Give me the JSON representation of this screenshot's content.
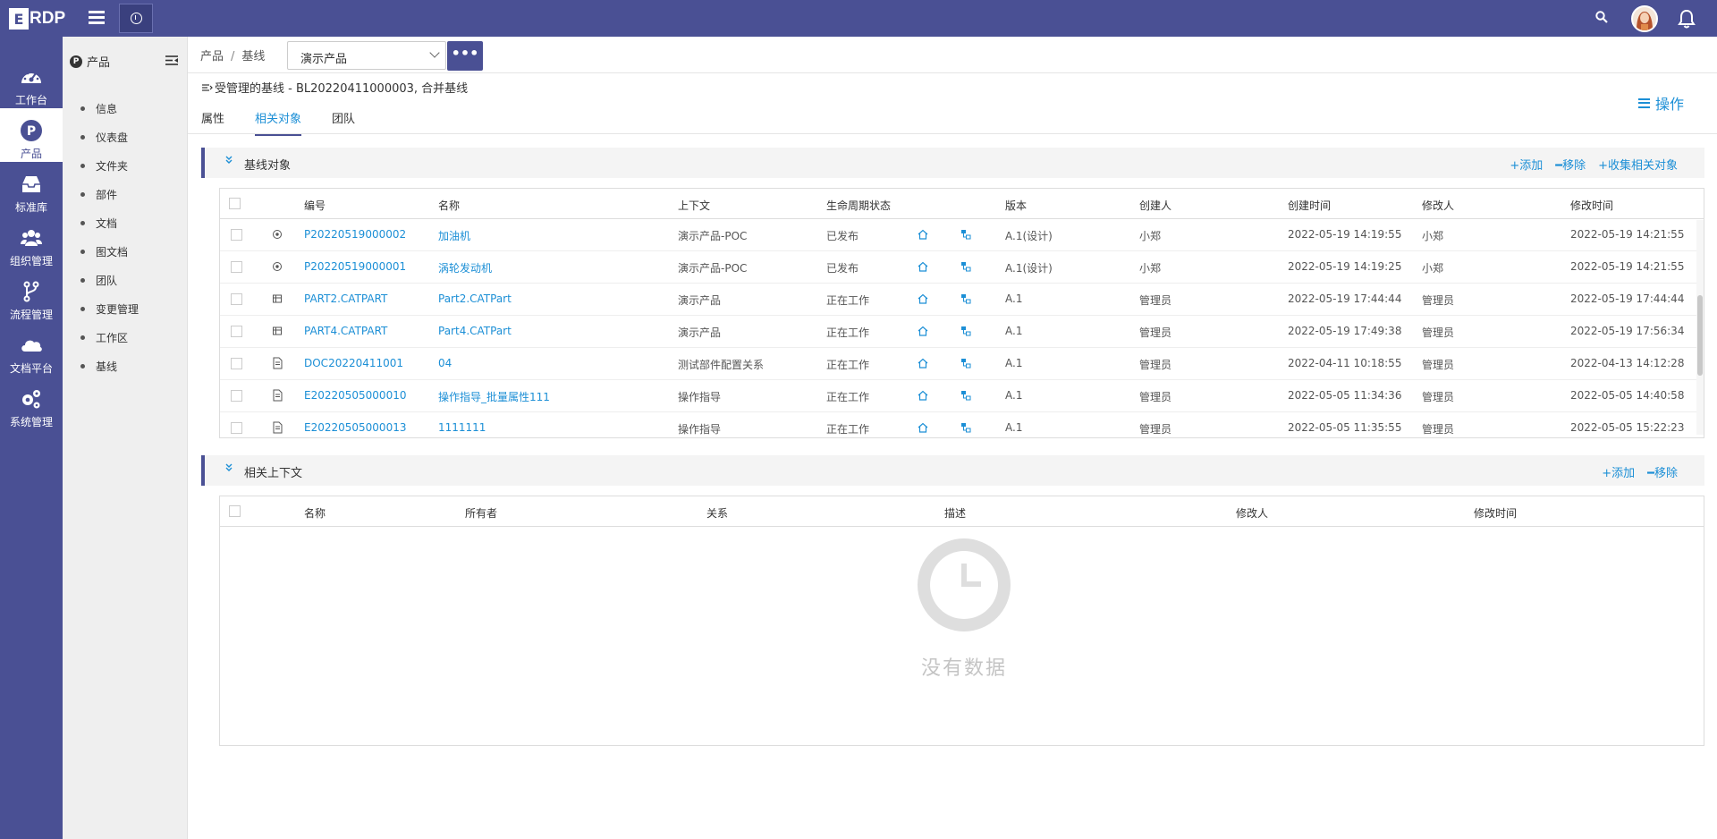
{
  "app": {
    "logo_box": "E",
    "logo_text": "RDP"
  },
  "rail": [
    {
      "label": "工作台",
      "icon": "dashboard-icon"
    },
    {
      "label": "产品",
      "icon": "product-icon",
      "active": true
    },
    {
      "label": "标准库",
      "icon": "inbox-icon"
    },
    {
      "label": "组织管理",
      "icon": "users-icon"
    },
    {
      "label": "流程管理",
      "icon": "flow-icon"
    },
    {
      "label": "文档平台",
      "icon": "cloud-icon"
    },
    {
      "label": "系统管理",
      "icon": "gears-icon"
    }
  ],
  "subnav": {
    "badge": "P",
    "title": "产品",
    "items": [
      "信息",
      "仪表盘",
      "文件夹",
      "部件",
      "文档",
      "图文档",
      "团队",
      "变更管理",
      "工作区",
      "基线"
    ]
  },
  "breadcrumb": {
    "items": [
      "产品",
      "基线"
    ],
    "sep": "/"
  },
  "context": {
    "selected": "演示产品",
    "more": "•••"
  },
  "doc_title": "受管理的基线 - BL20220411000003, 合并基线",
  "tabs": [
    "属性",
    "相关对象",
    "团队"
  ],
  "operate_label": "操作",
  "baseline_section": {
    "title": "基线对象",
    "actions": [
      "+添加",
      "━移除",
      "+收集相关对象"
    ],
    "columns": [
      "编号",
      "名称",
      "上下文",
      "生命周期状态",
      "版本",
      "创建人",
      "创建时间",
      "修改人",
      "修改时间"
    ],
    "rows": [
      {
        "type": "part",
        "number": "P20220519000002",
        "name": "加油机",
        "context": "演示产品-POC",
        "state": "已发布",
        "version": "A.1(设计)",
        "creator": "小郑",
        "created": "2022-05-19 14:19:55",
        "modifier": "小郑",
        "modified": "2022-05-19 14:21:55"
      },
      {
        "type": "part",
        "number": "P20220519000001",
        "name": "涡轮发动机",
        "context": "演示产品-POC",
        "state": "已发布",
        "version": "A.1(设计)",
        "creator": "小郑",
        "created": "2022-05-19 14:19:25",
        "modifier": "小郑",
        "modified": "2022-05-19 14:21:55"
      },
      {
        "type": "cad",
        "number": "PART2.CATPART",
        "name": "Part2.CATPart",
        "context": "演示产品",
        "state": "正在工作",
        "version": "A.1",
        "creator": "管理员",
        "created": "2022-05-19 17:44:44",
        "modifier": "管理员",
        "modified": "2022-05-19 17:44:44"
      },
      {
        "type": "cad",
        "number": "PART4.CATPART",
        "name": "Part4.CATPart",
        "context": "演示产品",
        "state": "正在工作",
        "version": "A.1",
        "creator": "管理员",
        "created": "2022-05-19 17:49:38",
        "modifier": "管理员",
        "modified": "2022-05-19 17:56:34"
      },
      {
        "type": "doc",
        "number": "DOC20220411001",
        "name": "04",
        "context": "测试部件配置关系",
        "state": "正在工作",
        "version": "A.1",
        "creator": "管理员",
        "created": "2022-04-11 10:18:55",
        "modifier": "管理员",
        "modified": "2022-04-13 14:12:28"
      },
      {
        "type": "doc",
        "number": "E20220505000010",
        "name": "操作指导_批量属性111",
        "context": "操作指导",
        "state": "正在工作",
        "version": "A.1",
        "creator": "管理员",
        "created": "2022-05-05 11:34:36",
        "modifier": "管理员",
        "modified": "2022-05-05 14:40:58"
      },
      {
        "type": "doc",
        "number": "E20220505000013",
        "name": "1111111",
        "context": "操作指导",
        "state": "正在工作",
        "version": "A.1",
        "creator": "管理员",
        "created": "2022-05-05 11:35:55",
        "modifier": "管理员",
        "modified": "2022-05-05 15:22:23"
      }
    ]
  },
  "context_section": {
    "title": "相关上下文",
    "actions": [
      "+添加",
      "━移除"
    ],
    "columns": [
      "名称",
      "所有者",
      "关系",
      "描述",
      "修改人",
      "修改时间"
    ],
    "empty_text": "没有数据"
  },
  "colors": {
    "brand": "#4a5094",
    "link": "#1c8fd6"
  }
}
